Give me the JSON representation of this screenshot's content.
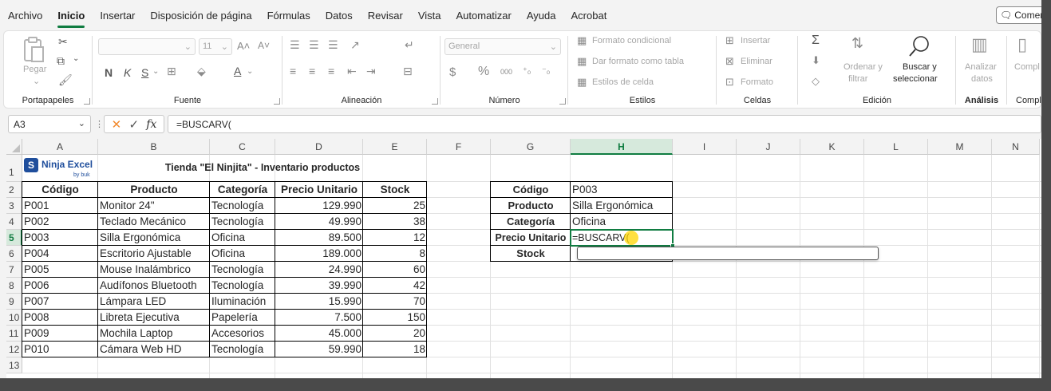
{
  "menu": {
    "tabs": [
      "Archivo",
      "Inicio",
      "Insertar",
      "Disposición de página",
      "Fórmulas",
      "Datos",
      "Revisar",
      "Vista",
      "Automatizar",
      "Ayuda",
      "Acrobat"
    ],
    "active_tab": "Inicio",
    "comment_button": "Comen"
  },
  "ribbon": {
    "clipboard": {
      "label": "Portapapeles",
      "paste": "Pegar"
    },
    "font": {
      "label": "Fuente",
      "size": "11",
      "bold": "N",
      "italic": "K",
      "underline": "S"
    },
    "alignment": {
      "label": "Alineación"
    },
    "number": {
      "label": "Número",
      "format": "General",
      "currency": "$",
      "percent": "%",
      "thousands": "000"
    },
    "styles": {
      "label": "Estilos",
      "conditional": "Formato condicional",
      "as_table": "Dar formato como tabla",
      "cell_styles": "Estilos de celda"
    },
    "cells": {
      "label": "Celdas",
      "insert": "Insertar",
      "delete": "Eliminar",
      "format": "Formato"
    },
    "editing": {
      "label": "Edición",
      "sort_line1": "Ordenar y",
      "sort_line2": "filtrar",
      "find_line1": "Buscar y",
      "find_line2": "seleccionar"
    },
    "analysis": {
      "label": "Análisis",
      "line1": "Analizar",
      "line2": "datos"
    },
    "comp": {
      "label": "Compl",
      "text": "Compl"
    }
  },
  "formula_bar": {
    "name_box": "A3",
    "formula": "=BUSCARV("
  },
  "columns": [
    "A",
    "B",
    "C",
    "D",
    "E",
    "F",
    "G",
    "H",
    "I",
    "J",
    "K",
    "L",
    "M",
    "N"
  ],
  "rows": [
    "1",
    "2",
    "3",
    "4",
    "5",
    "6",
    "7",
    "8",
    "9",
    "10",
    "11",
    "12",
    "13"
  ],
  "sheet": {
    "logo_text": "Ninja Excel",
    "logo_sub": "by buk",
    "title": "Tienda \"El Ninjita\" - Inventario productos",
    "headers": [
      "Código",
      "Producto",
      "Categoría",
      "Precio Unitario",
      "Stock"
    ],
    "products": [
      [
        "P001",
        "Monitor 24\"",
        "Tecnología",
        "129.990",
        "25"
      ],
      [
        "P002",
        "Teclado Mecánico",
        "Tecnología",
        "49.990",
        "38"
      ],
      [
        "P003",
        "Silla Ergonómica",
        "Oficina",
        "89.500",
        "12"
      ],
      [
        "P004",
        "Escritorio Ajustable",
        "Oficina",
        "189.000",
        "8"
      ],
      [
        "P005",
        "Mouse Inalámbrico",
        "Tecnología",
        "24.990",
        "60"
      ],
      [
        "P006",
        "Audífonos Bluetooth",
        "Tecnología",
        "39.990",
        "42"
      ],
      [
        "P007",
        "Lámpara LED",
        "Iluminación",
        "15.990",
        "70"
      ],
      [
        "P008",
        "Libreta Ejecutiva",
        "Papelería",
        "7.500",
        "150"
      ],
      [
        "P009",
        "Mochila Laptop",
        "Accesorios",
        "45.000",
        "20"
      ],
      [
        "P010",
        "Cámara Web HD",
        "Tecnología",
        "59.990",
        "18"
      ]
    ],
    "lookup": {
      "labels": [
        "Código",
        "Producto",
        "Categoría",
        "Precio Unitario",
        "Stock"
      ],
      "values": [
        "P003",
        "Silla Ergonómica",
        "Oficina",
        "=BUSCARV(",
        ""
      ]
    }
  }
}
